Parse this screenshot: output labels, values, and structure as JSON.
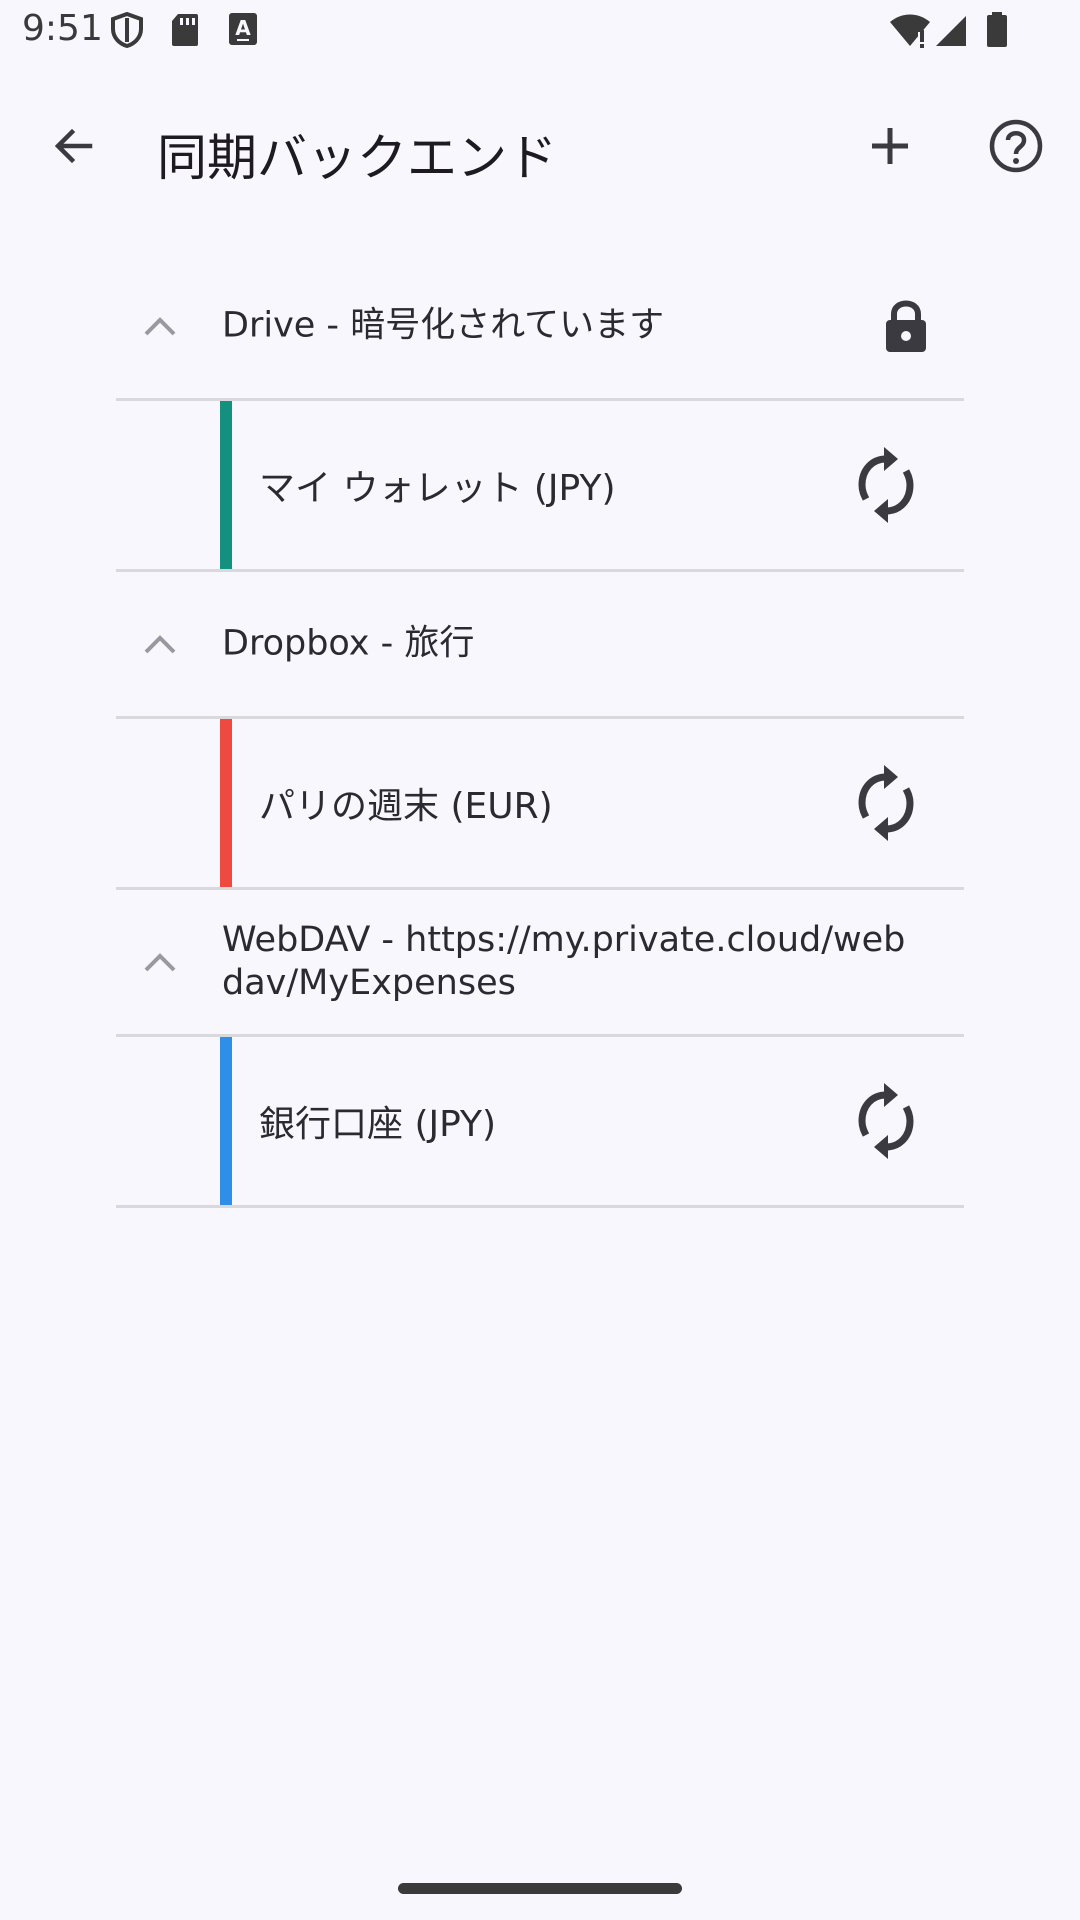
{
  "status_bar": {
    "time": "9:51",
    "left_icons": [
      "shield-icon",
      "sd-card-icon",
      "text-a-icon"
    ],
    "right_icons": [
      "wifi-icon",
      "signal-icon",
      "battery-icon"
    ]
  },
  "app_bar": {
    "title": "同期バックエンド",
    "actions": [
      "back-arrow-icon",
      "add-icon",
      "help-icon"
    ]
  },
  "backends": [
    {
      "label": "Drive - 暗号化されています",
      "expanded": true,
      "encrypted": true,
      "accounts": [
        {
          "label": "マイ ウォレット (JPY)",
          "color": "#13917e"
        }
      ]
    },
    {
      "label": "Dropbox - 旅行",
      "expanded": true,
      "encrypted": false,
      "accounts": [
        {
          "label": "パリの週末 (EUR)",
          "color": "#ef4a3f"
        }
      ]
    },
    {
      "label": "WebDAV - https://my.private.cloud/webdav/MyExpenses",
      "expanded": true,
      "encrypted": false,
      "accounts": [
        {
          "label": "銀行口座 (JPY)",
          "color": "#2f8fe8"
        }
      ]
    }
  ],
  "colors": {
    "background": "#f8f7fd",
    "divider": "#d9d8dd",
    "icon": "#3b3a40"
  }
}
